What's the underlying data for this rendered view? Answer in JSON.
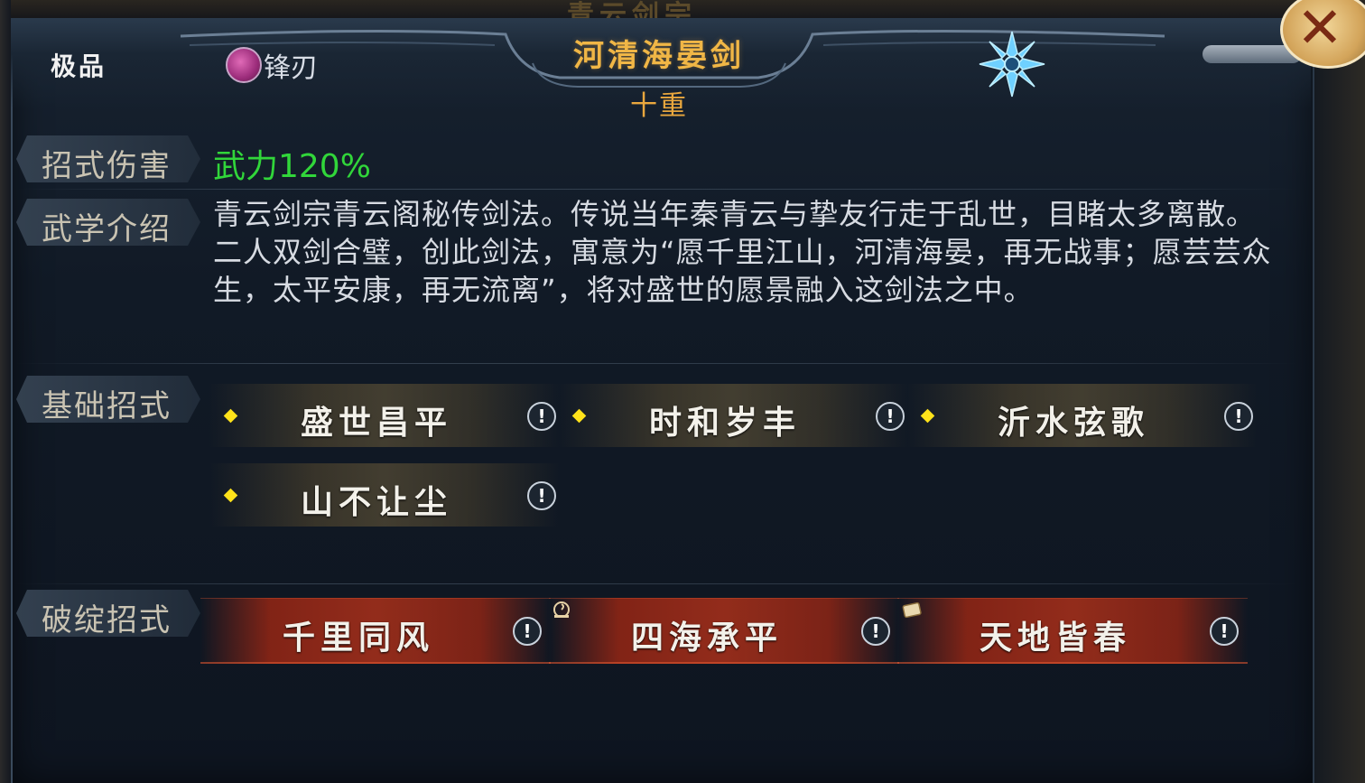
{
  "background": {
    "ghost_title": "青云剑宗"
  },
  "header": {
    "grade": "极品",
    "tag": {
      "icon": "blade-icon",
      "label": "锋刃"
    },
    "skill_name": "河清海晏剑",
    "skill_level": "十重",
    "element_icon": "snowflake-icon",
    "close_icon": "close-icon"
  },
  "sections": {
    "damage": {
      "label": "招式伤害",
      "value": "武力120%"
    },
    "intro": {
      "label": "武学介绍",
      "text": "青云剑宗青云阁秘传剑法。传说当年秦青云与挚友行走于乱世，目睹太多离散。二人双剑合璧，创此剑法，寓意为“愿千里江山，河清海晏，再无战事；愿芸芸众生，太平安康，再无流离”，将对盛世的愿景融入这剑法之中。"
    },
    "basic_moves": {
      "label": "基础招式",
      "items": [
        "盛世昌平",
        "时和岁丰",
        "沂水弦歌",
        "山不让尘"
      ]
    },
    "break_moves": {
      "label": "破绽招式",
      "items": [
        "千里同风",
        "四海承平",
        "天地皆春"
      ]
    }
  },
  "colors": {
    "title_gold": "#f0b646",
    "damage_green": "#31d63a",
    "diamond_yellow": "#ffe21a",
    "break_red": "#aa301a"
  }
}
